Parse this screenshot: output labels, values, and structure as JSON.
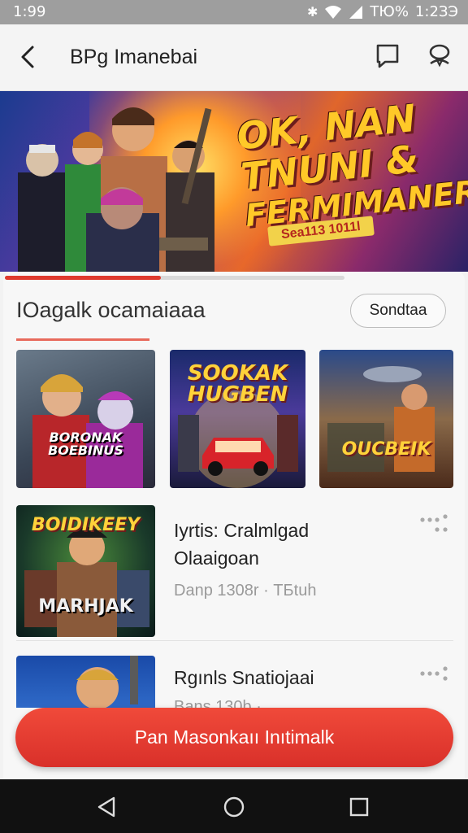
{
  "status_bar": {
    "time": "1:99",
    "battery": "ТЮ%",
    "clock": "1:2ЗЭ"
  },
  "app_bar": {
    "title": "BPg Imanebai"
  },
  "hero": {
    "headline_l1": "OK, NAN",
    "headline_l2": "TNUNI &",
    "headline_l3": "FERMIMANER",
    "tagline": "Sea113 1011l"
  },
  "carousel_progress": 0.46,
  "section": {
    "title": "IOagalk ocamaiaaa",
    "button_label": "Sondtaa",
    "thumbnails": [
      {
        "caption": "BORONAK BOEBINUS"
      },
      {
        "caption": "SOOKAK HUGBEN"
      },
      {
        "caption": "OUCBEIK"
      }
    ]
  },
  "list": [
    {
      "title_l1": "Iyrtis: Cralmlgad",
      "title_l2": "Olaaigoan",
      "meta": "Danp 1308r · ТБtuh",
      "art_caption_top": "BOIDIKEEY",
      "art_caption_bottom": "MARHJAK"
    },
    {
      "title_l1": "Rgınls Snatiojaai",
      "title_l2": "",
      "meta": "Bans 130b · ...",
      "art_caption_top": "",
      "art_caption_bottom": ""
    }
  ],
  "cta_label": "Pan Masonkaıı Inıtimalk",
  "colors": {
    "accent": "#e03a2e",
    "status_bar": "#9e9e9e",
    "nav_bar": "#111111"
  }
}
